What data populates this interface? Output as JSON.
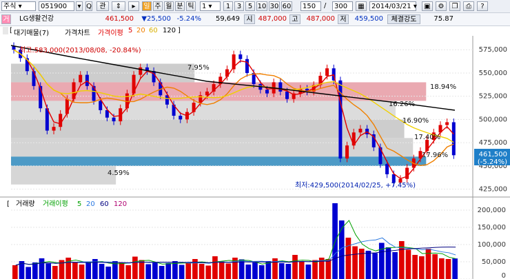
{
  "toolbar": {
    "market": "주식",
    "code": "051900",
    "btn_gwan": "관",
    "period_btns": [
      "주",
      "월",
      "분",
      "틱"
    ],
    "interval": "1",
    "interval_btns": [
      "1",
      "3",
      "5",
      "10",
      "30",
      "60"
    ],
    "count": "150",
    "slash": "/",
    "total": "300",
    "date": "2014/03/21"
  },
  "quote": {
    "tag": "거",
    "name": "LG생활건강",
    "price": "461,500",
    "change": "▼25,500",
    "pct": "-5.24%",
    "volume": "59,649",
    "open_label": "시",
    "open": "487,000",
    "high_label": "고",
    "high": "487,000",
    "low_label": "저",
    "low": "459,500",
    "strength_label": "체결강도",
    "strength": "75.87"
  },
  "legend": {
    "bracket": "[",
    "bracket_close": "]",
    "main": "대기매물(7)",
    "sep": "가격차트",
    "price_ma": "가격이평",
    "ma": [
      "5",
      "20",
      "60",
      "120"
    ],
    "ma_colors": [
      "#e00000",
      "#f08000",
      "#f0d000",
      "#000000"
    ]
  },
  "volume_legend": {
    "a": "거래량",
    "b": "거래이평",
    "ma": [
      "5",
      "20",
      "60",
      "120"
    ],
    "ma_colors": [
      "#00a000",
      "#2a78e0",
      "#000080",
      "#b00070"
    ]
  },
  "annotations": {
    "max": "최고:583,000(2013/08/08, -20.84%)",
    "min": "최저:429,500(2014/02/25, +7.45%)",
    "pct_bands": [
      "7.95%",
      "18.94%",
      "16.26%",
      "16.90%",
      "17.40%",
      "17.96%",
      "4.59%"
    ]
  },
  "chart_data": [
    {
      "type": "candlestick",
      "title": "",
      "y_ticks": [
        "575,000",
        "550,000",
        "525,000",
        "500,000",
        "475,000",
        "450,000",
        "425,000"
      ],
      "ylim": [
        418000,
        590000
      ],
      "current": {
        "price": "461,500",
        "pct": "(-5.24%)"
      },
      "series": [
        {
          "values": [
            575000,
            566000,
            552000,
            536000,
            512000,
            488000,
            492000,
            506000,
            522000,
            540000,
            548000,
            536000,
            520000,
            510000,
            502000,
            498000,
            512000,
            528000,
            548000,
            556000,
            552000,
            540000,
            526000,
            516000,
            504000,
            500000,
            508000,
            518000,
            526000,
            530000,
            538000,
            546000,
            554000,
            570000,
            565000,
            550000,
            538000,
            532000,
            528000,
            540000,
            530000,
            522000,
            528000,
            533000,
            530000,
            537000,
            547000,
            555000,
            542000,
            458000,
            472000,
            486000,
            490000,
            484000,
            470000,
            452000,
            441000,
            432000,
            436000,
            448000,
            458000,
            466000,
            478000,
            486000,
            494000,
            497000,
            461500
          ]
        }
      ]
    },
    {
      "type": "bar",
      "title": "",
      "y_ticks": [
        "200,000",
        "150,000",
        "100,000",
        "50,000",
        "0"
      ],
      "ylim": [
        0,
        230000
      ],
      "series": [
        {
          "values": [
            40000,
            52000,
            35000,
            48000,
            60000,
            45000,
            38000,
            55000,
            62000,
            48000,
            42000,
            50000,
            58000,
            44000,
            36000,
            52000,
            47000,
            40000,
            65000,
            55000,
            43000,
            49000,
            38000,
            46000,
            52000,
            41000,
            47000,
            58000,
            44000,
            39000,
            66000,
            51000,
            45000,
            62000,
            57000,
            42000,
            48000,
            40000,
            52000,
            60000,
            46000,
            44000,
            70000,
            50000,
            42000,
            55000,
            62000,
            58000,
            220000,
            170000,
            120000,
            95000,
            88000,
            82000,
            75000,
            105000,
            92000,
            78000,
            110000,
            85000,
            70000,
            66000,
            88000,
            72000,
            60000,
            58000,
            59649
          ]
        }
      ]
    }
  ]
}
